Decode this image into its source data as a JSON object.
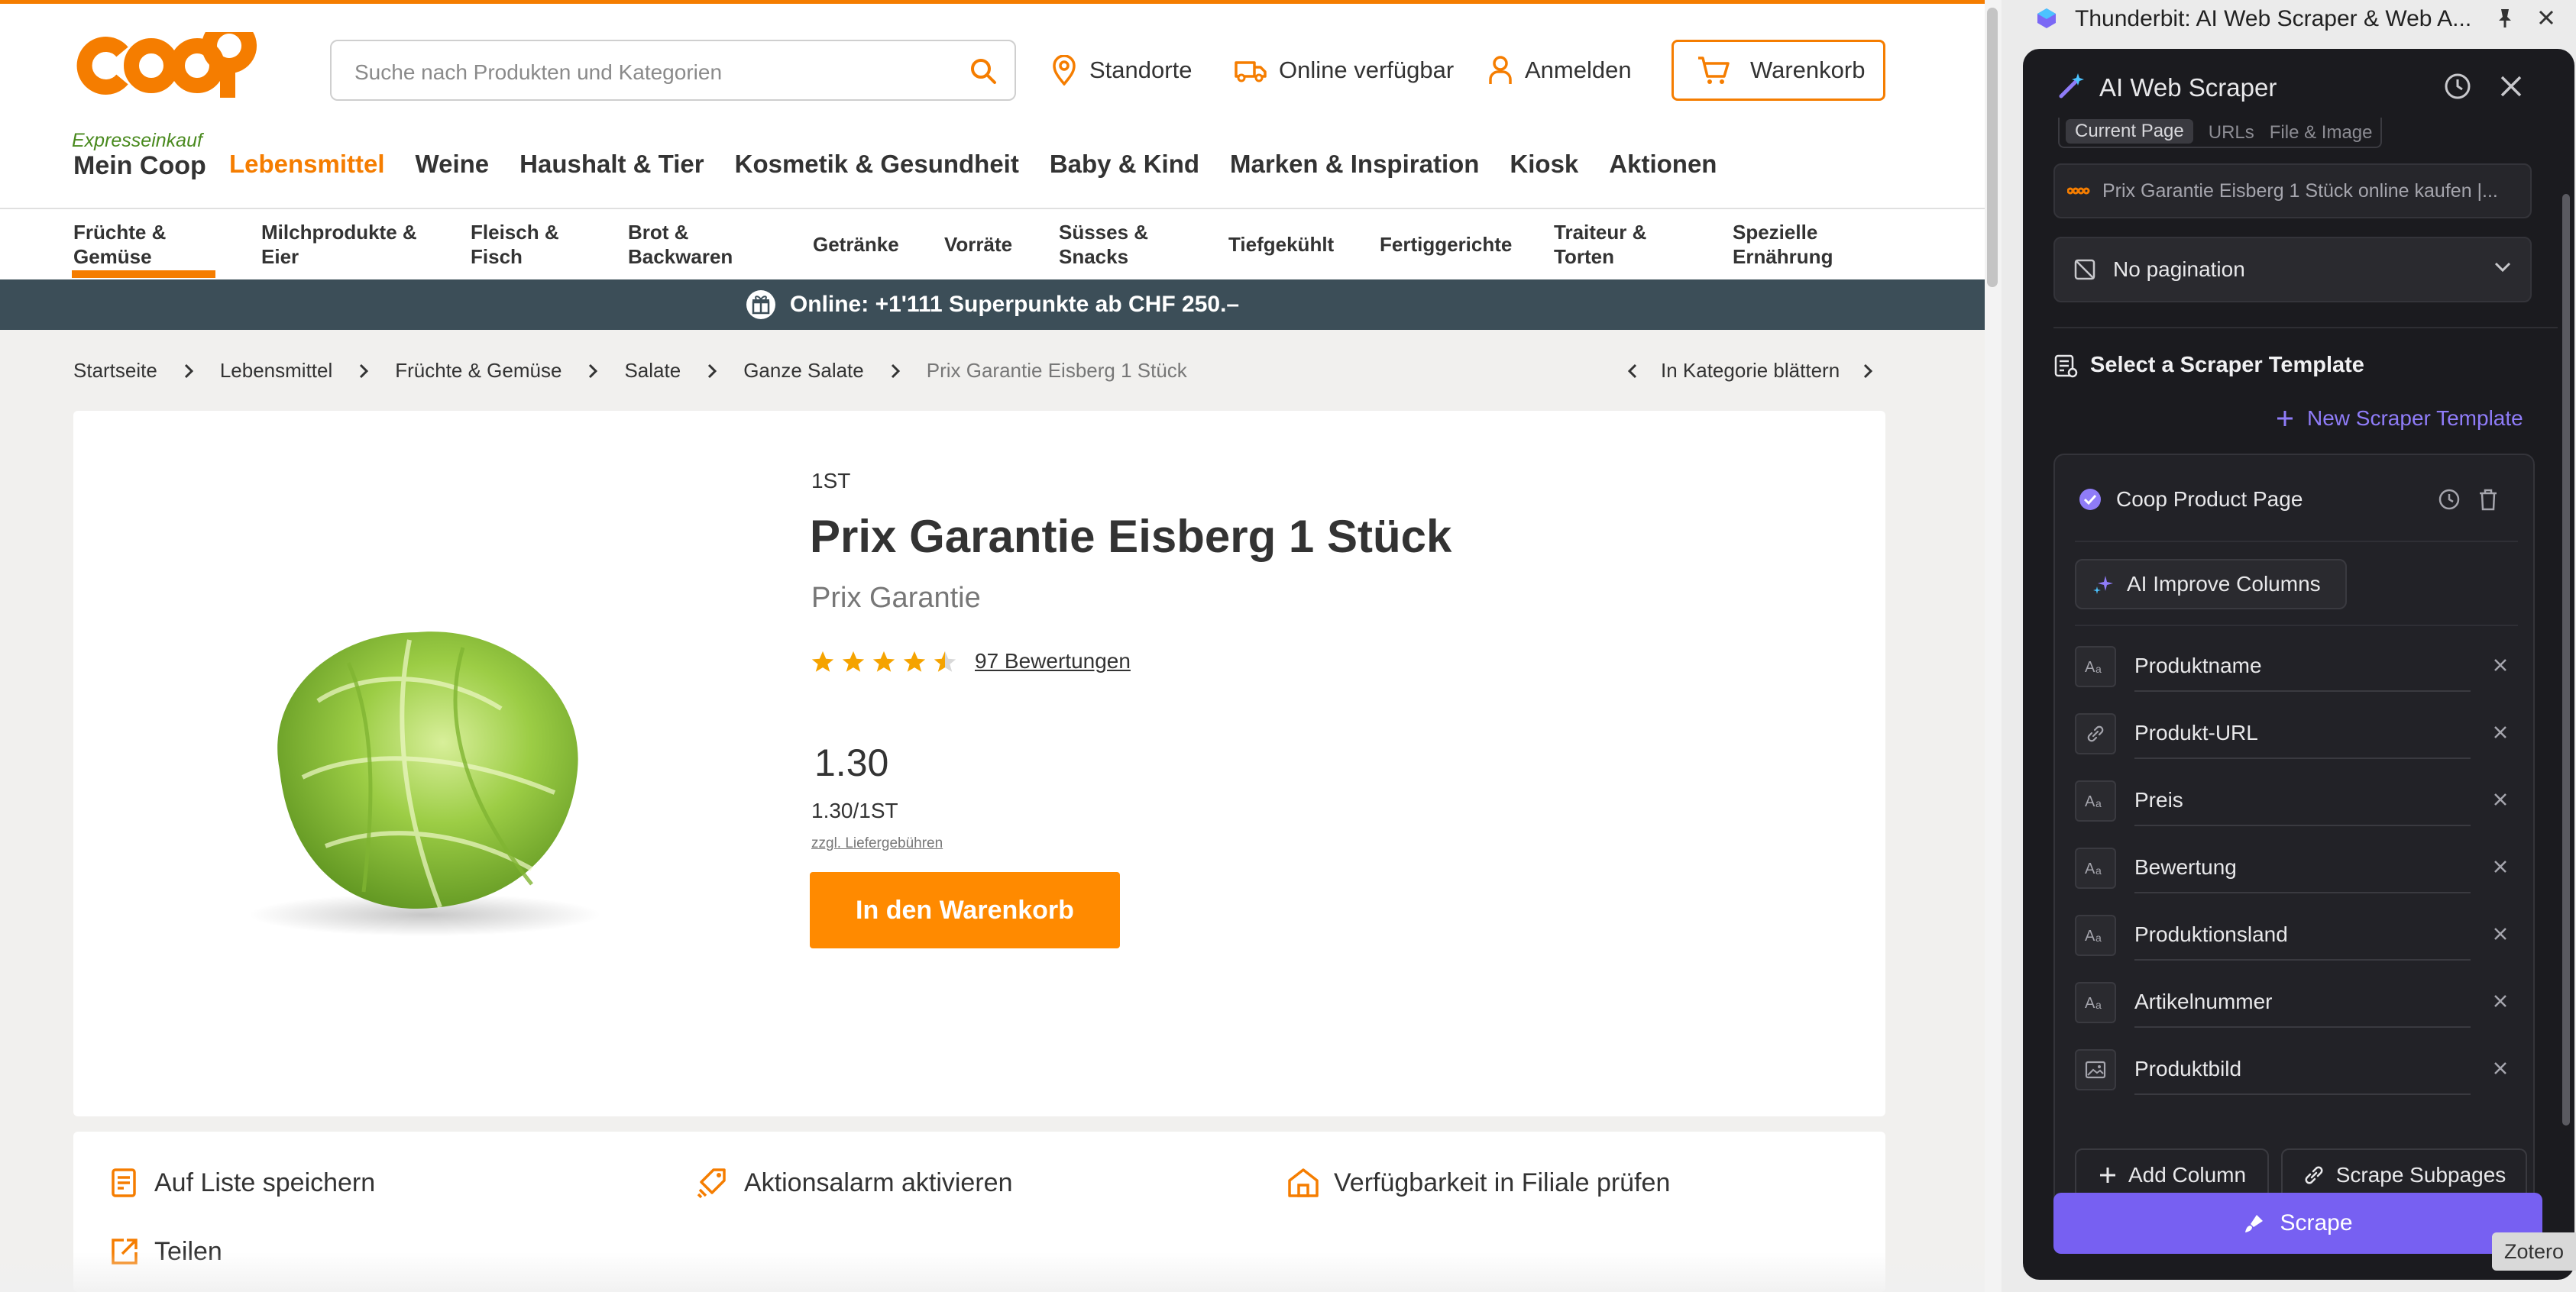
{
  "shop": {
    "logo_text": "coop",
    "search_placeholder": "Suche nach Produkten und Kategorien",
    "top_nav": [
      {
        "label": "Standorte",
        "icon": "location-pin-icon"
      },
      {
        "label": "Online verfügbar",
        "icon": "delivery-truck-icon"
      },
      {
        "label": "Anmelden",
        "icon": "user-icon"
      }
    ],
    "cart_label": "Warenkorb",
    "express_label": "Expresseinkauf",
    "mein_coop": "Mein Coop",
    "main_nav": [
      "Lebensmittel",
      "Weine",
      "Haushalt & Tier",
      "Kosmetik & Gesundheit",
      "Baby & Kind",
      "Marken & Inspiration",
      "Kiosk",
      "Aktionen"
    ],
    "main_nav_active": "Lebensmittel",
    "categories": [
      [
        "Früchte &",
        "Gemüse"
      ],
      [
        "Milchprodukte &",
        "Eier"
      ],
      [
        "Fleisch &",
        "Fisch"
      ],
      [
        "Brot &",
        "Backwaren"
      ],
      [
        "Getränke"
      ],
      [
        "Vorräte"
      ],
      [
        "Süsses &",
        "Snacks"
      ],
      [
        "Tiefgekühlt"
      ],
      [
        "Fertiggerichte"
      ],
      [
        "Traiteur &",
        "Torten"
      ],
      [
        "Spezielle",
        "Ernährung"
      ]
    ],
    "promo_text": "Online: +1'111 Superpunkte ab CHF 250.–",
    "breadcrumb": [
      "Startseite",
      "Lebensmittel",
      "Früchte & Gemüse",
      "Salate",
      "Ganze Salate",
      "Prix Garantie Eisberg 1 Stück"
    ],
    "browse_label": "In Kategorie blättern",
    "product": {
      "unit": "1ST",
      "title": "Prix Garantie Eisberg 1 Stück",
      "brand": "Prix Garantie",
      "rating": 4.5,
      "rating_max": 5,
      "reviews": "97 Bewertungen",
      "price": "1.30",
      "unit_price": "1.30/1ST",
      "fees": "zzgl. Liefergebühren",
      "add_to_cart": "In den Warenkorb"
    },
    "actions": {
      "save_list": "Auf Liste speichern",
      "alarm": "Aktionsalarm aktivieren",
      "availability": "Verfügbarkeit in Filiale prüfen",
      "share": "Teilen"
    },
    "accent_color": "#f57d00"
  },
  "extension": {
    "window_title": "Thunderbit: AI Web Scraper & Web A...",
    "panel_title": "AI Web Scraper",
    "tabs": [
      "Current Page",
      "URLs",
      "File & Image"
    ],
    "active_tab": "Current Page",
    "url_text": "Prix Garantie Eisberg 1 Stück online kaufen |...",
    "pagination": "No pagination",
    "select_template": "Select a Scraper Template",
    "new_template": "New Scraper Template",
    "template_name": "Coop Product Page",
    "improve_columns": "AI Improve Columns",
    "columns": [
      {
        "name": "Produktname",
        "icon": "text-type-icon"
      },
      {
        "name": "Produkt-URL",
        "icon": "link-icon"
      },
      {
        "name": "Preis",
        "icon": "text-type-icon"
      },
      {
        "name": "Bewertung",
        "icon": "text-type-icon"
      },
      {
        "name": "Produktionsland",
        "icon": "text-type-icon"
      },
      {
        "name": "Artikelnummer",
        "icon": "text-type-icon"
      },
      {
        "name": "Produktbild",
        "icon": "image-type-icon"
      }
    ],
    "add_column": "Add Column",
    "scrape_subpages": "Scrape Subpages",
    "scrape_button": "Scrape",
    "accent_color": "#7760f2"
  },
  "zotero_label": "Zotero"
}
